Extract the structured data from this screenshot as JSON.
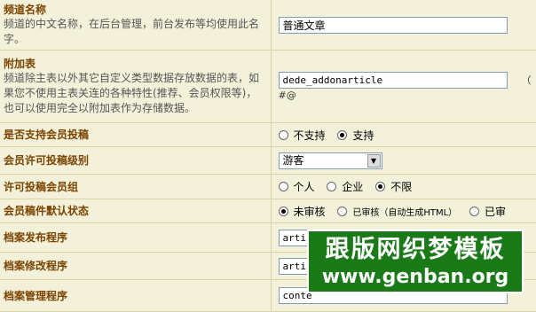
{
  "rows": [
    {
      "title": "频道名称",
      "desc": "频道的中文名称，在后台管理，前台发布等均使用此名字。",
      "value": "普通文章"
    },
    {
      "title": "附加表",
      "desc": "频道除主表以外其它自定义类型数据存放数据的表，如果您不使用主表关连的各种特性(推荐、会员权限等)，也可以使用完全以附加表作为存储数据。",
      "value": "dede_addonarticle",
      "trail": "（ #@"
    },
    {
      "title": "是否支持会员投稿",
      "options": [
        "不支持",
        "支持"
      ]
    },
    {
      "title": "会员许可投稿级别",
      "select": "游客"
    },
    {
      "title": "许可投稿会员组",
      "options": [
        "个人",
        "企业",
        "不限"
      ]
    },
    {
      "title": "会员稿件默认状态",
      "options": [
        "未审核",
        "已审核（自动生成HTML）",
        "已审"
      ]
    },
    {
      "title": "档案发布程序",
      "value": "artic"
    },
    {
      "title": "档案修改程序",
      "value": "artic"
    },
    {
      "title": "档案管理程序",
      "value": "conte"
    }
  ],
  "selected": {
    "row2": 1,
    "row4": 2,
    "row5": 0
  },
  "watermark": {
    "line1": "跟版网织梦模板",
    "line2": "www.genban.org",
    "color": "#1b7a18"
  },
  "colors": {
    "label_title": "#7a4400",
    "row_bg": "#f4f1da",
    "border": "#d9d3a8"
  }
}
